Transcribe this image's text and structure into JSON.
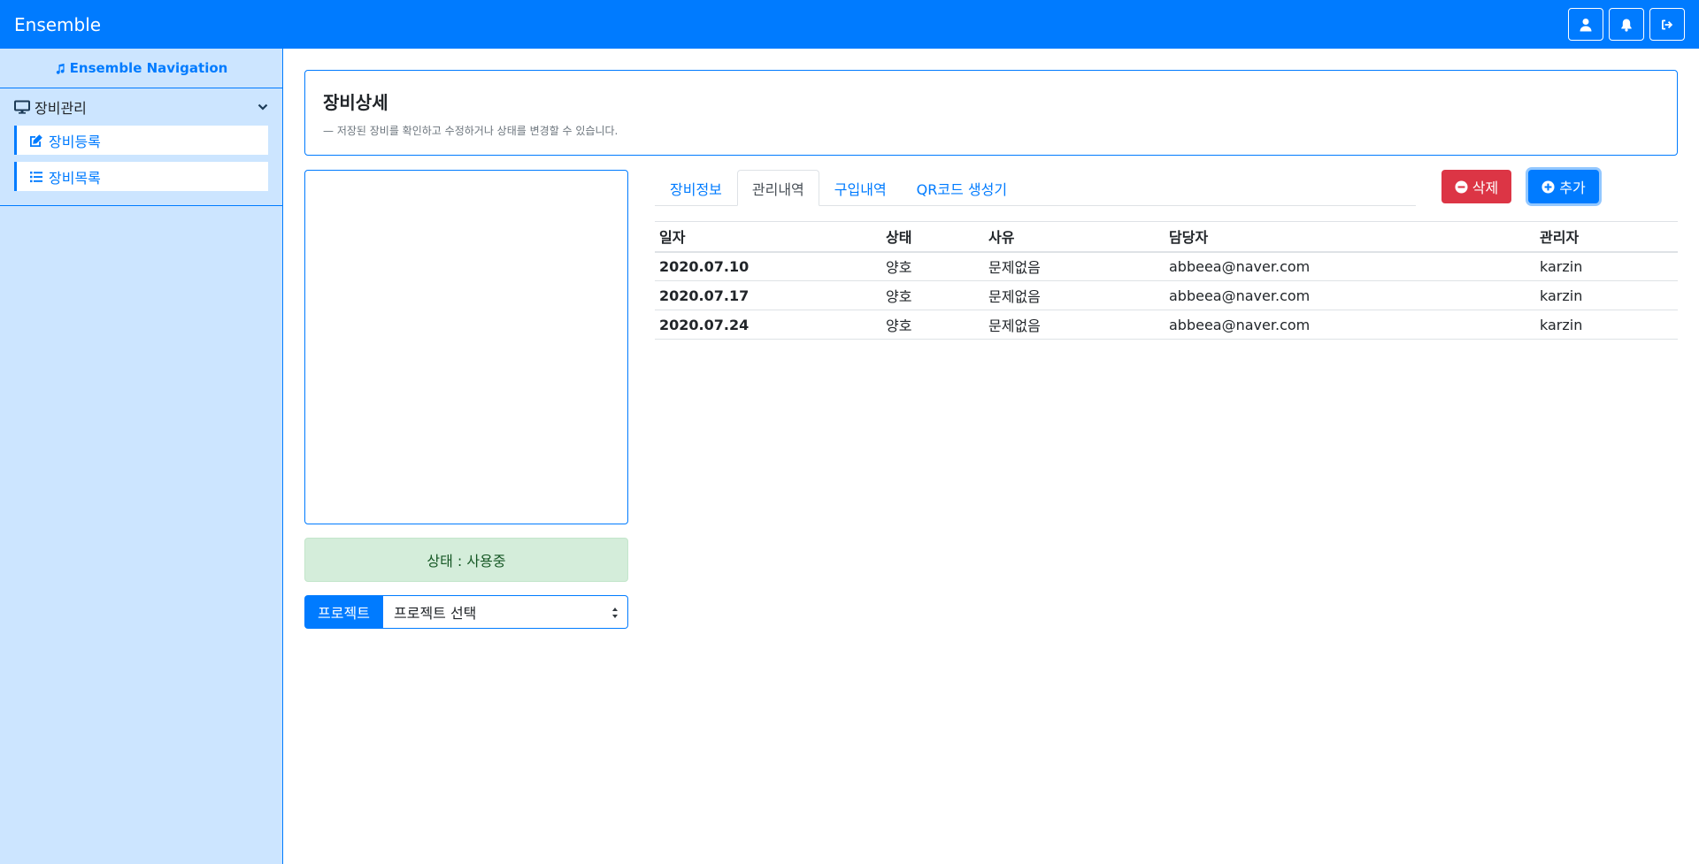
{
  "navbar": {
    "brand": "Ensemble",
    "buttons": [
      {
        "icon": "user-icon"
      },
      {
        "icon": "bell-icon"
      },
      {
        "icon": "sign-out-icon"
      }
    ]
  },
  "sidebar": {
    "header": "Ensemble Navigation",
    "group": {
      "label": "장비관리",
      "items": [
        {
          "label": "장비등록",
          "icon": "edit-icon"
        },
        {
          "label": "장비목록",
          "icon": "list-icon"
        }
      ]
    }
  },
  "page": {
    "title": "장비상세",
    "description": "— 저장된 장비를 확인하고 수정하거나 상태를 변경할 수 있습니다."
  },
  "status": {
    "text": "상태 : 사용중"
  },
  "project": {
    "label": "프로젝트",
    "selected": "프로젝트 선택"
  },
  "tabs": [
    {
      "label": "장비정보",
      "active": false
    },
    {
      "label": "관리내역",
      "active": true
    },
    {
      "label": "구입내역",
      "active": false
    },
    {
      "label": "QR코드 생성기",
      "active": false
    }
  ],
  "actions": {
    "delete_label": "삭제",
    "add_label": "추가"
  },
  "table": {
    "headers": [
      "일자",
      "상태",
      "사유",
      "담당자",
      "관리자"
    ],
    "rows": [
      [
        "2020.07.10",
        "양호",
        "문제없음",
        "abbeea@naver.com",
        "karzin"
      ],
      [
        "2020.07.17",
        "양호",
        "문제없음",
        "abbeea@naver.com",
        "karzin"
      ],
      [
        "2020.07.24",
        "양호",
        "문제없음",
        "abbeea@naver.com",
        "karzin"
      ]
    ]
  },
  "colors": {
    "primary": "#007bff",
    "danger": "#dc3545",
    "sidebar_bg": "#cce5ff",
    "status_bg": "#d4edda",
    "status_text": "#155724"
  }
}
